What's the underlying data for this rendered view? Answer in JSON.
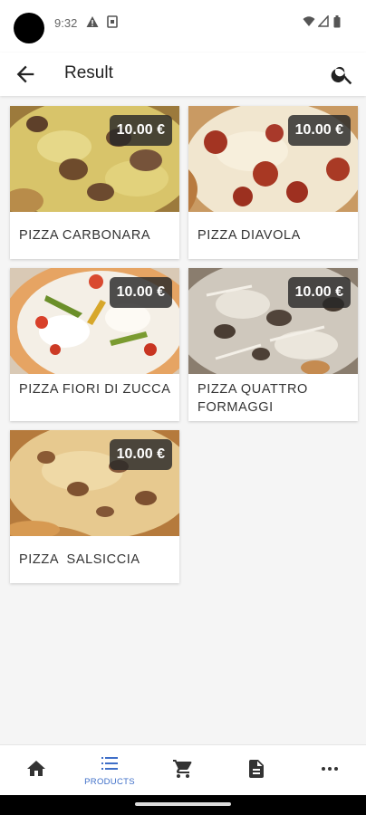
{
  "status_bar": {
    "time": "9:32"
  },
  "app_bar": {
    "title": "Result"
  },
  "products": [
    {
      "name": "PIZZA CARBONARA",
      "price": "10.00 €"
    },
    {
      "name": "PIZZA DIAVOLA",
      "price": "10.00 €"
    },
    {
      "name": "PIZZA FIORI DI ZUCCA",
      "price": "10.00 €"
    },
    {
      "name": "PIZZA QUATTRO FORMAGGI",
      "price": "10.00 €"
    },
    {
      "name": "PIZZA  SALSICCIA",
      "price": "10.00 €"
    }
  ],
  "bottom_nav": {
    "items": [
      {
        "icon": "home-icon",
        "label": ""
      },
      {
        "icon": "list-icon",
        "label": "PRODUCTS"
      },
      {
        "icon": "cart-icon",
        "label": ""
      },
      {
        "icon": "document-icon",
        "label": ""
      },
      {
        "icon": "more-icon",
        "label": ""
      }
    ],
    "active_index": 1
  },
  "colors": {
    "accent": "#3f6fc8",
    "price_badge": "#282828"
  }
}
